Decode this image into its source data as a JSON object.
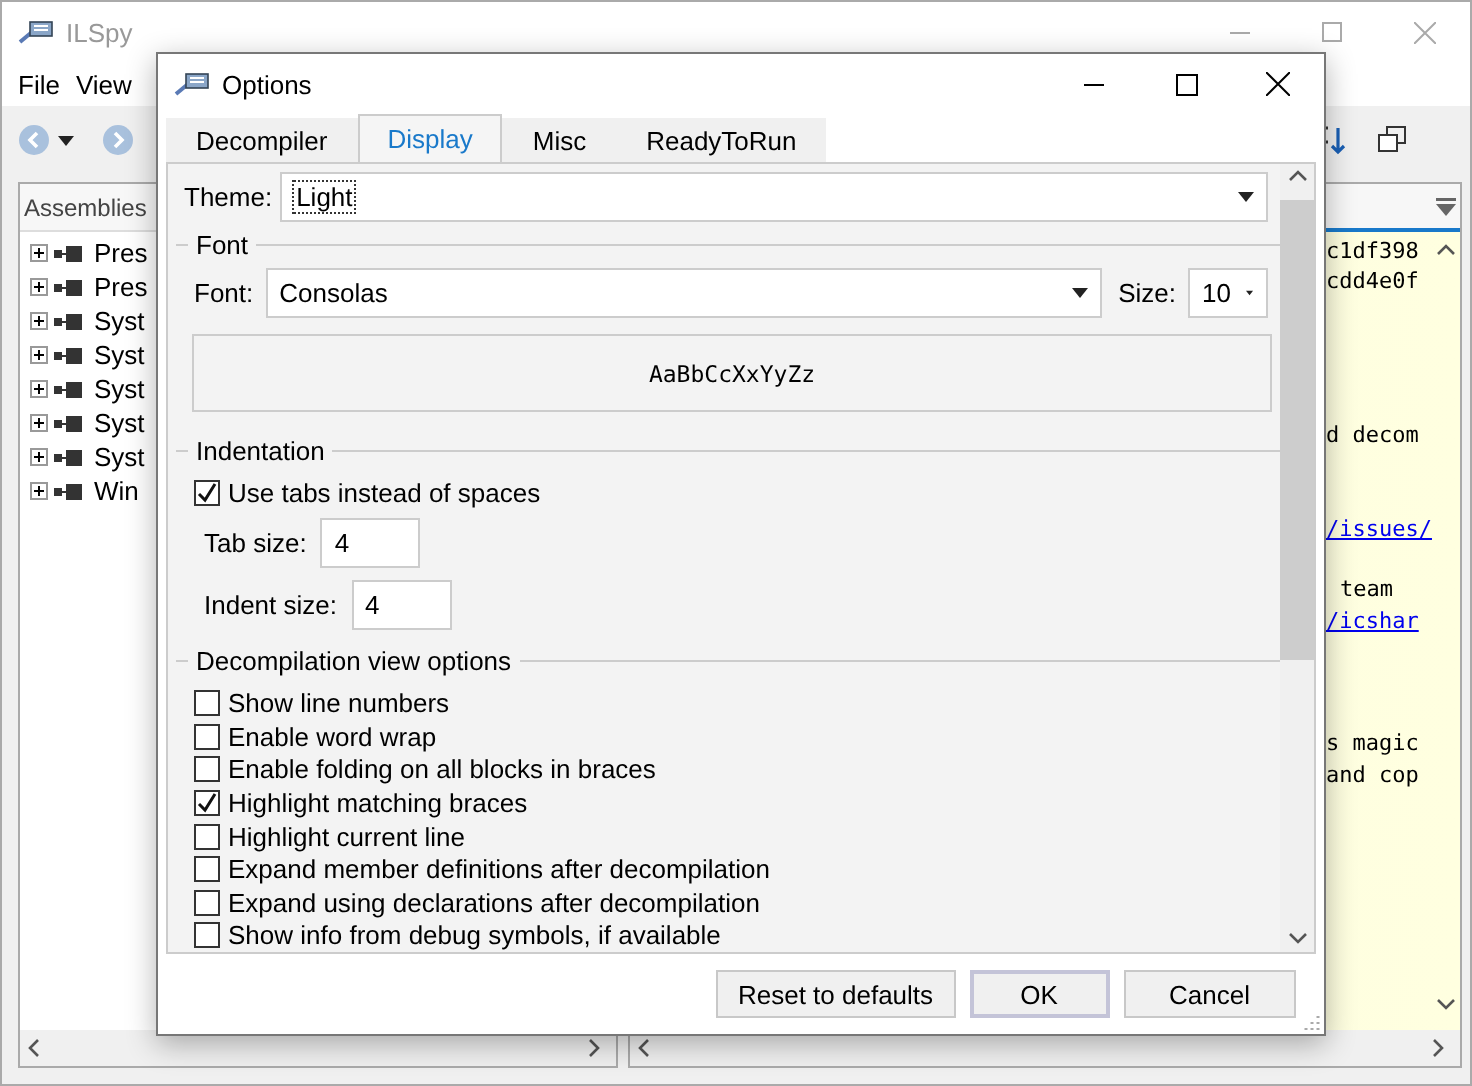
{
  "main_window": {
    "title": "ILSpy",
    "menu": [
      "File",
      "View"
    ],
    "assemblies_header": "Assemblies",
    "tree_items": [
      {
        "label": "Pres",
        "expanded": false
      },
      {
        "label": "Pres",
        "expanded": false
      },
      {
        "label": "Syst",
        "expanded": false
      },
      {
        "label": "Syst",
        "expanded": false
      },
      {
        "label": "Syst",
        "expanded": false
      },
      {
        "label": "Syst",
        "expanded": false
      },
      {
        "label": "Syst",
        "expanded": false
      },
      {
        "label": "Win",
        "expanded": false
      }
    ],
    "code_lines": [
      {
        "text": "c1df398",
        "kind": "plain"
      },
      {
        "text": "cdd4e0f",
        "kind": "plain"
      },
      {
        "text": "d decom",
        "kind": "plain"
      },
      {
        "text": "/issues/",
        "kind": "link"
      },
      {
        "text": "team",
        "kind": "plain"
      },
      {
        "text": "/icshar",
        "kind": "link"
      },
      {
        "text": "s magic",
        "kind": "plain"
      },
      {
        "text": "and cop",
        "kind": "plain"
      }
    ]
  },
  "dialog": {
    "title": "Options",
    "tabs": [
      {
        "label": "Decompiler",
        "selected": false
      },
      {
        "label": "Display",
        "selected": true
      },
      {
        "label": "Misc",
        "selected": false
      },
      {
        "label": "ReadyToRun",
        "selected": false
      }
    ],
    "theme": {
      "label": "Theme:",
      "value": "Light",
      "focused": true
    },
    "font_group": {
      "title": "Font",
      "font_label": "Font:",
      "font_value": "Consolas",
      "size_label": "Size:",
      "size_value": "10",
      "sample": "AaBbCcXxYyZz"
    },
    "indentation_group": {
      "title": "Indentation",
      "use_tabs": {
        "label": "Use tabs instead of spaces",
        "checked": true
      },
      "tab_size_label": "Tab size:",
      "tab_size": "4",
      "indent_size_label": "Indent size:",
      "indent_size": "4"
    },
    "view_options": {
      "title": "Decompilation view options",
      "options": [
        {
          "label": "Show line numbers",
          "checked": false
        },
        {
          "label": "Enable word wrap",
          "checked": false
        },
        {
          "label": "Enable folding on all blocks in braces",
          "checked": false
        },
        {
          "label": "Highlight matching braces",
          "checked": true
        },
        {
          "label": "Highlight current line",
          "checked": false
        },
        {
          "label": "Expand member definitions after decompilation",
          "checked": false
        },
        {
          "label": "Expand using declarations after decompilation",
          "checked": false
        },
        {
          "label": "Show info from debug symbols, if available",
          "checked": false
        }
      ]
    },
    "buttons": [
      {
        "label": "Reset to defaults",
        "default": false
      },
      {
        "label": "OK",
        "default": true
      },
      {
        "label": "Cancel",
        "default": false
      }
    ]
  }
}
